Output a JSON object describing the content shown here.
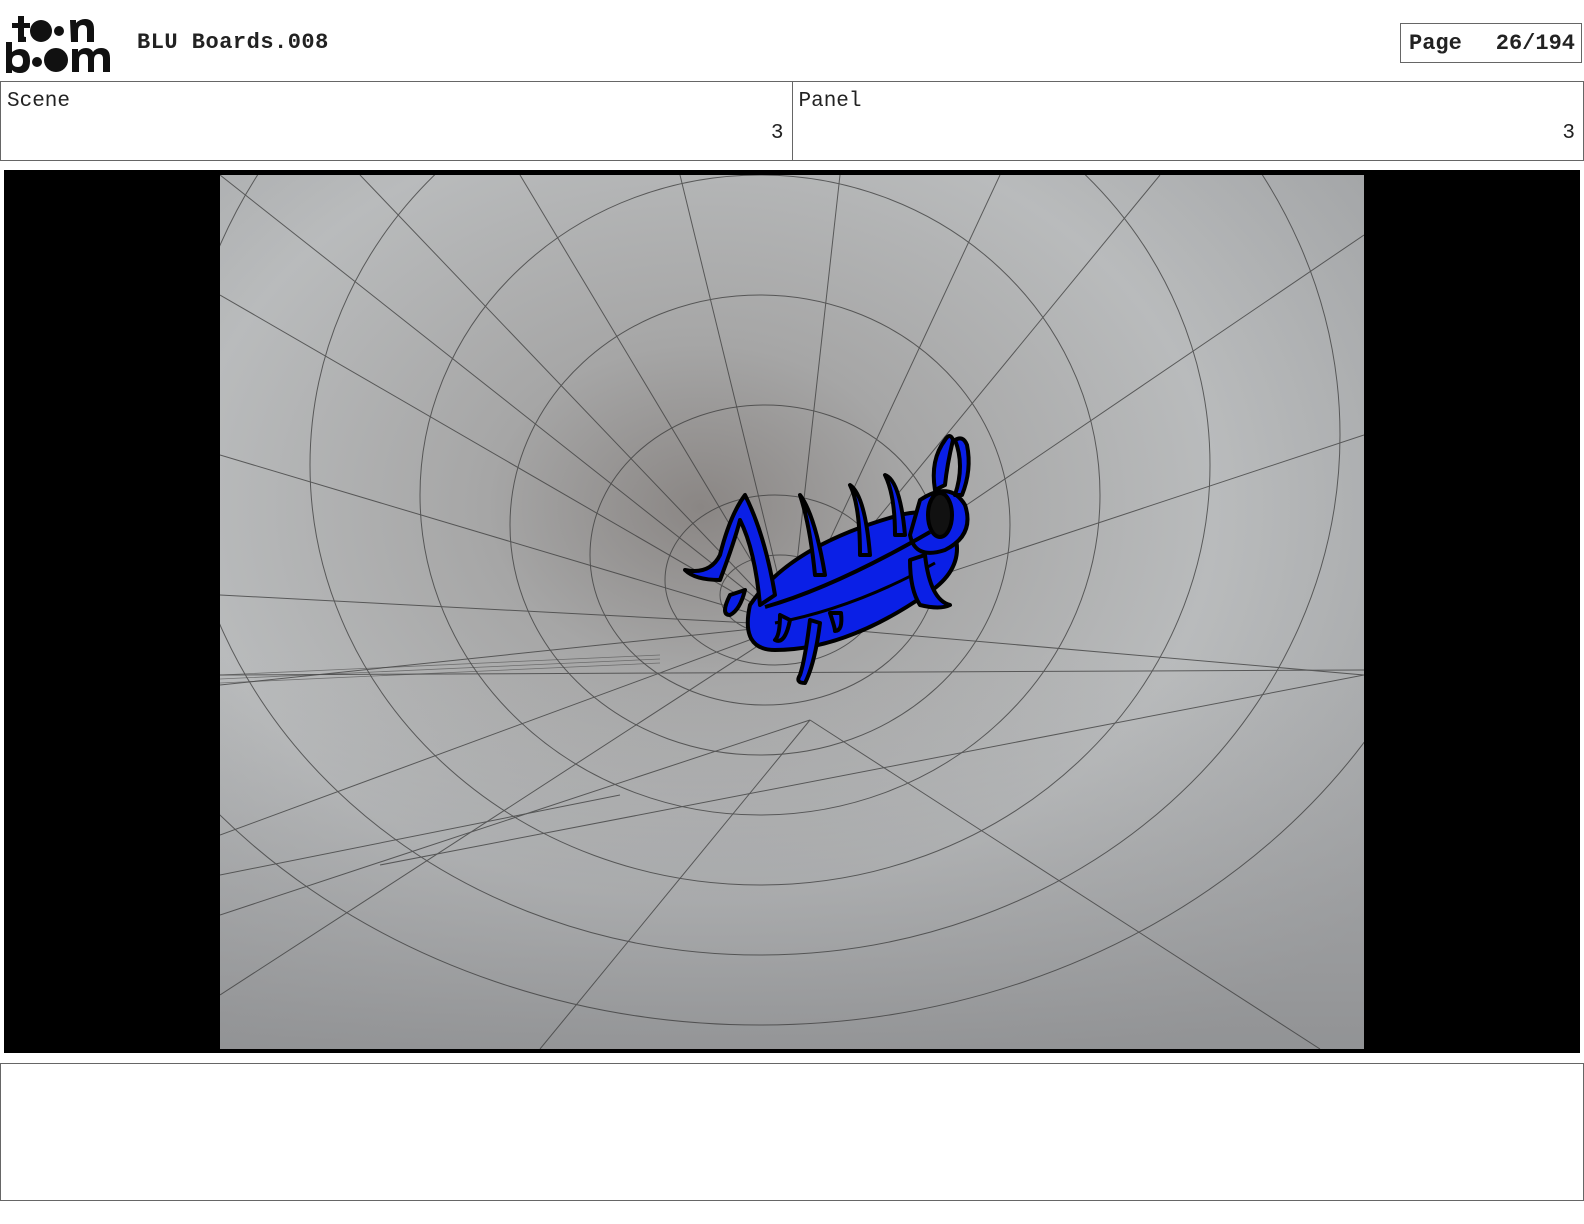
{
  "header": {
    "logo_text": "toon boom",
    "title": "BLU Boards.008",
    "page_label": "Page",
    "page_value": "26/194"
  },
  "info": {
    "scene_label": "Scene",
    "scene_value": "3",
    "panel_label": "Panel",
    "panel_value": "3"
  },
  "panel_image": {
    "subject": "blue-beetle-icon",
    "background_color": "#000000",
    "beetle_color": "#0a1fe6"
  },
  "notes": {
    "text": ""
  }
}
